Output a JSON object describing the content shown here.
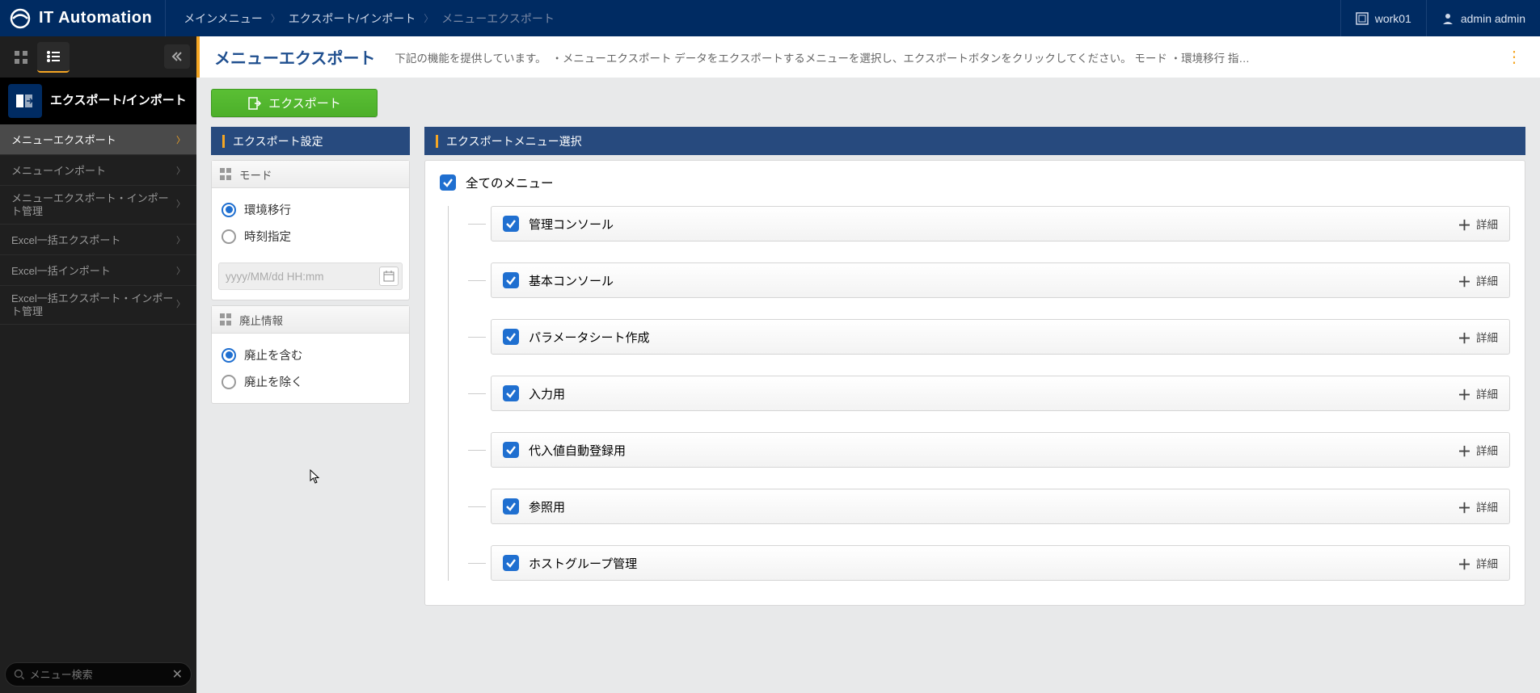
{
  "header": {
    "product": "IT Automation",
    "breadcrumb": [
      "メインメニュー",
      "エクスポート/インポート",
      "メニューエクスポート"
    ],
    "workspace": "work01",
    "user": "admin admin"
  },
  "sidebar": {
    "section_title": "エクスポート/インポート",
    "items": [
      {
        "label": "メニューエクスポート",
        "selected": true,
        "tall": false
      },
      {
        "label": "メニューインポート",
        "selected": false,
        "tall": false
      },
      {
        "label": "メニューエクスポート・インポート管理",
        "selected": false,
        "tall": true
      },
      {
        "label": "Excel一括エクスポート",
        "selected": false,
        "tall": false
      },
      {
        "label": "Excel一括インポート",
        "selected": false,
        "tall": false
      },
      {
        "label": "Excel一括エクスポート・インポート管理",
        "selected": false,
        "tall": true
      }
    ],
    "search_placeholder": "メニュー検索"
  },
  "page": {
    "title": "メニューエクスポート",
    "description": "下記の機能を提供しています。　・メニューエクスポート データをエクスポートするメニューを選択し、エクスポートボタンをクリックしてください。 モード ・環境移行 指…",
    "export_button": "エクスポート"
  },
  "settings_panel": {
    "title": "エクスポート設定",
    "mode_group": "モード",
    "mode_options": [
      "環境移行",
      "時刻指定"
    ],
    "date_placeholder": "yyyy/MM/dd HH:mm",
    "abolish_group": "廃止情報",
    "abolish_options": [
      "廃止を含む",
      "廃止を除く"
    ]
  },
  "menu_panel": {
    "title": "エクスポートメニュー選択",
    "root": "全てのメニュー",
    "detail_label": "詳細",
    "items": [
      "管理コンソール",
      "基本コンソール",
      "パラメータシート作成",
      "入力用",
      "代入値自動登録用",
      "参照用",
      "ホストグループ管理"
    ]
  }
}
